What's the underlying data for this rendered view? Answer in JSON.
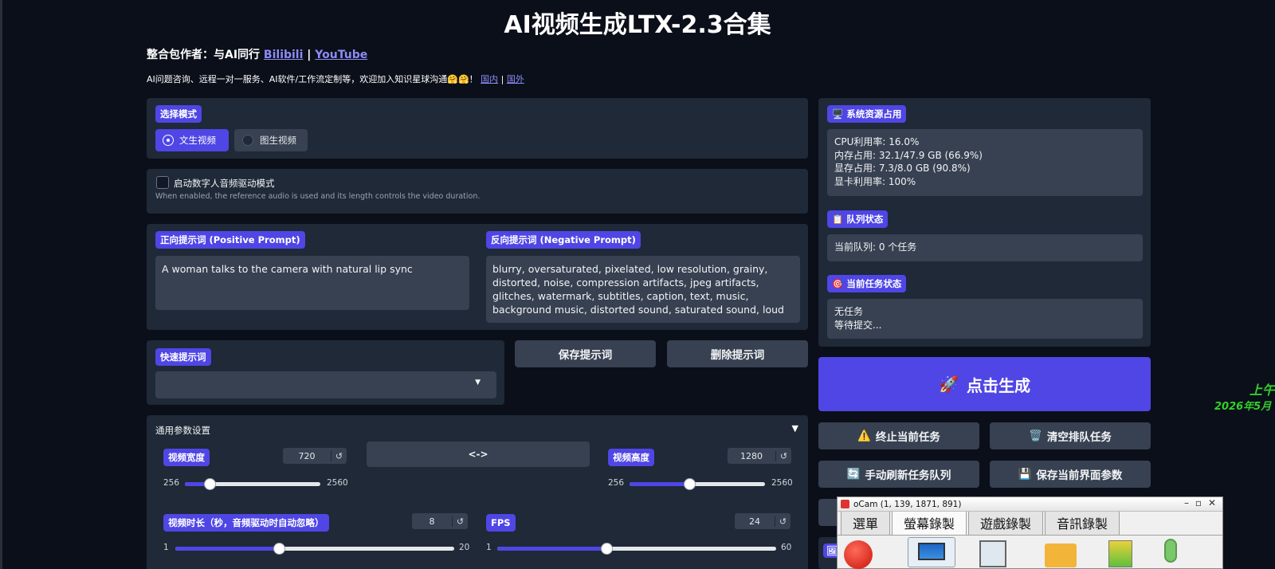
{
  "title": "AI视频生成LTX-2.3合集",
  "author": {
    "prefix": "整合包作者：与AI同行 ",
    "link1": "Bilibili",
    "sep": " | ",
    "link2": "YouTube"
  },
  "info": {
    "text": "AI问题咨询、远程一对一服务、AI软件/工作流定制等，欢迎加入知识星球沟通🤗🤗！ ",
    "link1": "国内",
    "sep": " | ",
    "link2": "国外"
  },
  "mode": {
    "label": "选择模式",
    "options": [
      "文生视频",
      "图生视频"
    ],
    "selected": "文生视频"
  },
  "digital_human": {
    "label": "启动数字人音频驱动模式",
    "hint": "When enabled, the reference audio is used and its length controls the video duration.",
    "checked": false
  },
  "prompts": {
    "positive_label": "正向提示词 (Positive Prompt)",
    "positive_value": "A woman talks to the camera with natural lip sync",
    "negative_label": "反向提示词 (Negative Prompt)",
    "negative_value": "blurry, oversaturated, pixelated, low resolution, grainy, distorted, noise, compression artifacts, jpeg artifacts, glitches, watermark, subtitles, caption, text, music, background music, distorted sound, saturated sound, loud"
  },
  "quick": {
    "label": "快速提示词",
    "dropdown_value": "",
    "save": "保存提示词",
    "delete": "删除提示词"
  },
  "params": {
    "header": "通用参数设置",
    "collapse_icon": "▼",
    "swap": "<->",
    "reset_glyph": "↺",
    "width": {
      "label": "视频宽度",
      "value": "720",
      "min": "256",
      "max": "2560",
      "fraction": 0.18
    },
    "height": {
      "label": "视频高度",
      "value": "1280",
      "min": "256",
      "max": "2560",
      "fraction": 0.44
    },
    "duration": {
      "label": "视频时长（秒，音频驱动时自动忽略）",
      "value": "8",
      "min": "1",
      "max": "20",
      "fraction": 0.37
    },
    "fps": {
      "label": "FPS",
      "value": "24",
      "min": "1",
      "max": "60",
      "fraction": 0.39
    }
  },
  "system": {
    "label": "系统资源占用",
    "lines": [
      "CPU利用率: 16.0%",
      "内存占用: 32.1/47.9 GB (66.9%)",
      "显存占用: 7.3/8.0 GB (90.8%)",
      "显卡利用率: 100%"
    ]
  },
  "queue": {
    "label": "队列状态",
    "text": "当前队列: 0 个任务"
  },
  "task": {
    "label": "当前任务状态",
    "lines": [
      "无任务",
      "等待提交..."
    ]
  },
  "actions": {
    "generate": "点击生成",
    "stop": "终止当前任务",
    "clear": "清空排队任务",
    "refresh": "手动刷新任务队列",
    "save_params": "保存当前界面参数"
  },
  "side": {
    "line1": "上午",
    "line2": "2026年5月"
  },
  "ocam": {
    "title": "oCam (1, 139, 1871, 891)",
    "tabs": [
      "選單",
      "螢幕錄製",
      "遊戲錄製",
      "音訊錄製"
    ],
    "active_tab": "螢幕錄製"
  },
  "colors": {
    "accent": "#4f46e5",
    "panel": "#1f2937",
    "background": "#0b0f19",
    "side_green": "#32d02a"
  }
}
